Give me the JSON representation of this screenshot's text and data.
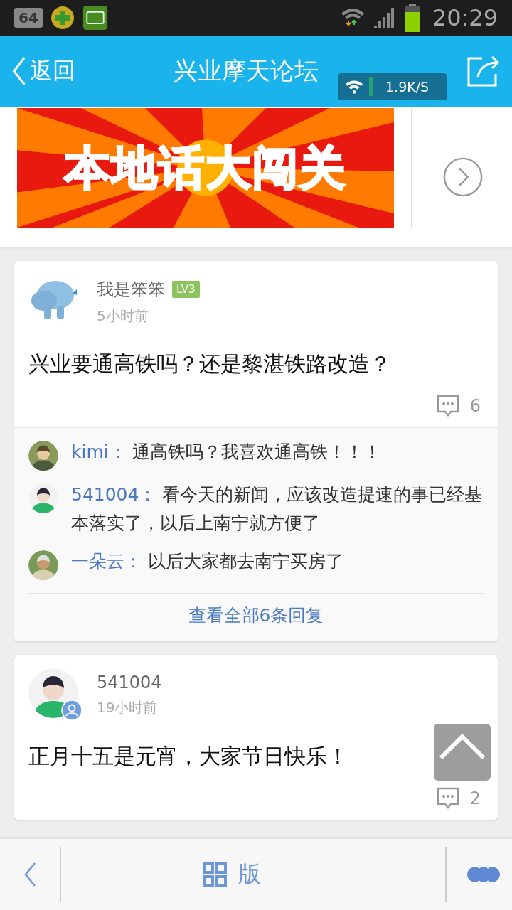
{
  "status_bar": {
    "battery_app_label": "64",
    "time": "20:29"
  },
  "header": {
    "back": "返回",
    "title": "兴业摩天论坛",
    "net_speed": "1.9K/S"
  },
  "banner": {
    "title": "本地话大闯关"
  },
  "posts": [
    {
      "author": "我是笨笨",
      "level": "LV3",
      "time": "5小时前",
      "verified": false,
      "text": "兴业要通高铁吗？还是黎湛铁路改造？",
      "comments": "6",
      "replies": [
        {
          "name": "kimi：",
          "text": "通高铁吗？我喜欢通高铁！！！"
        },
        {
          "name": "541004：",
          "text": "看今天的新闻，应该改造提速的事已经基本落实了，以后上南宁就方便了"
        },
        {
          "name": "一朵云：",
          "text": "以后大家都去南宁买房了"
        }
      ],
      "view_all": "查看全部6条回复"
    },
    {
      "author": "541004",
      "time": "19小时前",
      "verified": true,
      "text": "正月十五是元宵，大家节日快乐！",
      "comments": "2"
    }
  ],
  "bottom_bar": {
    "board_label": "版"
  }
}
